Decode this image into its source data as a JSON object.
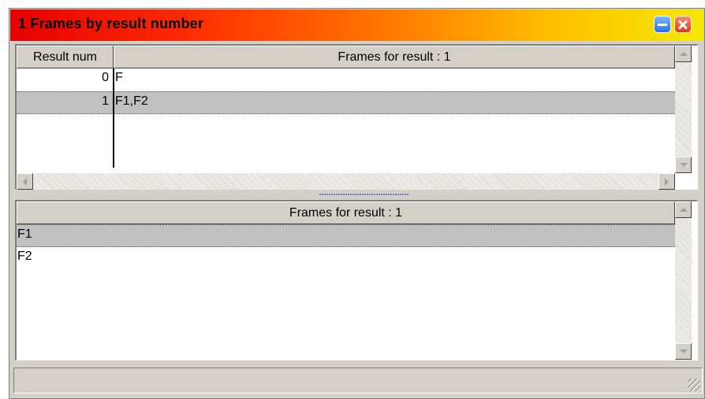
{
  "window": {
    "title": "1  Frames by result number",
    "buttons": {
      "minimize": "minimize",
      "close": "close"
    }
  },
  "top_table": {
    "columns": [
      "Result num",
      "Frames for result : 1"
    ],
    "rows": [
      {
        "num": "0",
        "frames": "F",
        "selected": false
      },
      {
        "num": "1",
        "frames": "F1,F2",
        "selected": true
      }
    ]
  },
  "bottom_list": {
    "header": "Frames for result : 1",
    "items": [
      {
        "label": "F1",
        "selected": true
      },
      {
        "label": "F2",
        "selected": false
      }
    ]
  },
  "colors": {
    "selection": "#c0c0c0",
    "face": "#d4d0c8",
    "title_start": "#e60000",
    "title_end": "#f4e800"
  },
  "icons": [
    "minimize-icon",
    "close-icon",
    "scroll-up-icon",
    "scroll-down-icon",
    "scroll-left-icon",
    "scroll-right-icon",
    "size-grip-icon"
  ]
}
